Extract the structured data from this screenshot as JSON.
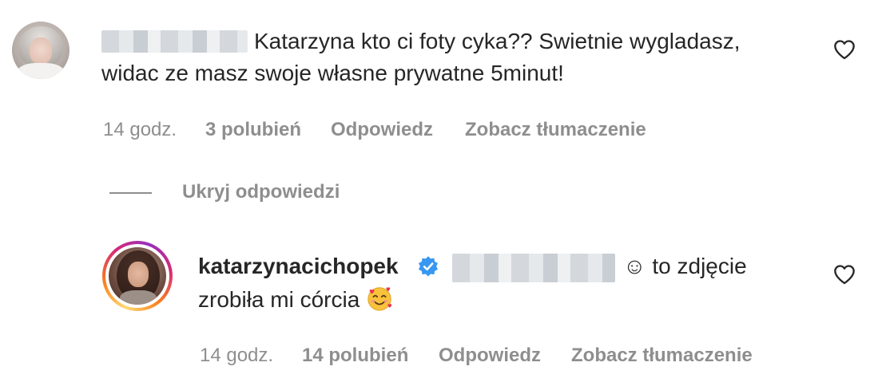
{
  "comments": [
    {
      "text_line1": "Katarzyna kto ci foty cyka?? Swietnie wygladasz,",
      "text_line2": "widac ze masz swoje własne prywatne 5minut!",
      "time": "14 godz.",
      "likes": "3 polubień",
      "reply": "Odpowiedz",
      "translate": "Zobacz tłumaczenie"
    },
    {
      "username": "katarzynacichopek",
      "text_part1": "☺ to zdjęcie",
      "text_line2": "zrobiła mi córcia",
      "emoji": "smiling-face-with-hearts",
      "time": "14 godz.",
      "likes": "14 polubień",
      "reply": "Odpowiedz",
      "translate": "Zobacz tłumaczenie"
    }
  ],
  "replies_toggle": "Ukryj odpowiedzi",
  "colors": {
    "text": "#262626",
    "secondary": "#8e8e8e",
    "verified": "#3897f0"
  }
}
